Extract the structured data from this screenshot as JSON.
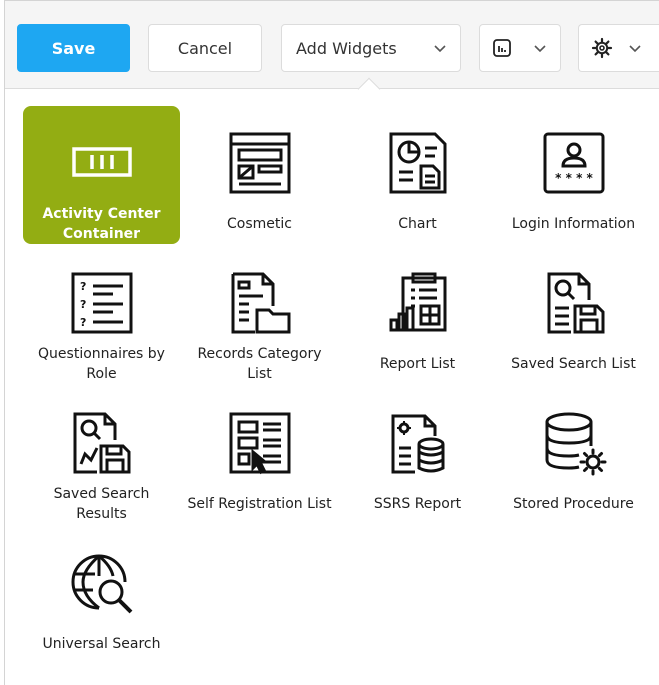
{
  "toolbar": {
    "save_label": "Save",
    "cancel_label": "Cancel",
    "add_widgets_label": "Add Widgets",
    "chart_dropdown_icon": "bar-chart-icon",
    "settings_dropdown_icon": "gear-icon"
  },
  "colors": {
    "save_blue": "#1ea7f2",
    "active_tile_green": "#93ad13"
  },
  "widgets": [
    {
      "label": "Activity Center Container",
      "icon": "container-icon",
      "selected": true
    },
    {
      "label": "Cosmetic",
      "icon": "layout-icon",
      "selected": false
    },
    {
      "label": "Chart",
      "icon": "chart-document-icon",
      "selected": false
    },
    {
      "label": "Login Information",
      "icon": "login-card-icon",
      "selected": false
    },
    {
      "label": "Questionnaires by Role",
      "icon": "questionnaire-icon",
      "selected": false
    },
    {
      "label": "Records Category List",
      "icon": "records-folder-icon",
      "selected": false
    },
    {
      "label": "Report List",
      "icon": "report-clipboard-icon",
      "selected": false
    },
    {
      "label": "Saved Search List",
      "icon": "saved-search-icon",
      "selected": false
    },
    {
      "label": "Saved Search Results",
      "icon": "saved-search-results-icon",
      "selected": false
    },
    {
      "label": "Self Registration List",
      "icon": "self-registration-icon",
      "selected": false
    },
    {
      "label": "SSRS Report",
      "icon": "ssrs-report-icon",
      "selected": false
    },
    {
      "label": "Stored Procedure",
      "icon": "database-gear-icon",
      "selected": false
    },
    {
      "label": "Universal Search",
      "icon": "globe-search-icon",
      "selected": false
    }
  ]
}
